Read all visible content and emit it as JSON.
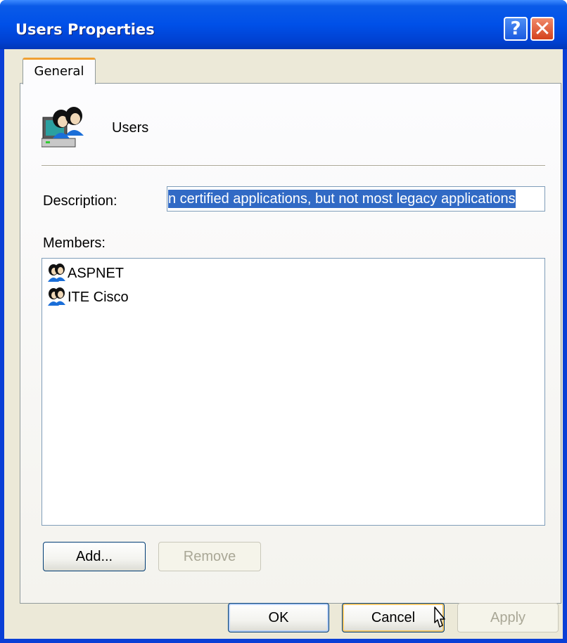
{
  "window": {
    "title": "Users Properties"
  },
  "titlebar": {
    "help_label": "?",
    "close_label": "✕"
  },
  "tabs": [
    {
      "label": "General"
    }
  ],
  "group": {
    "name": "Users"
  },
  "description": {
    "label": "Description:",
    "visible_value": "n certified applications, but not most legacy applications"
  },
  "members": {
    "label": "Members:",
    "items": [
      {
        "name": "ASPNET",
        "icon": "user-icon"
      },
      {
        "name": "ITE Cisco",
        "icon": "user-icon"
      }
    ]
  },
  "buttons": {
    "add": "Add...",
    "remove": "Remove",
    "ok": "OK",
    "cancel": "Cancel",
    "apply": "Apply"
  },
  "colors": {
    "titlebar": "#0050e8",
    "selection": "#316ac5",
    "dialog_bg": "#ece9d8",
    "close_button": "#d4411c",
    "tab_accent": "#f0a032"
  }
}
